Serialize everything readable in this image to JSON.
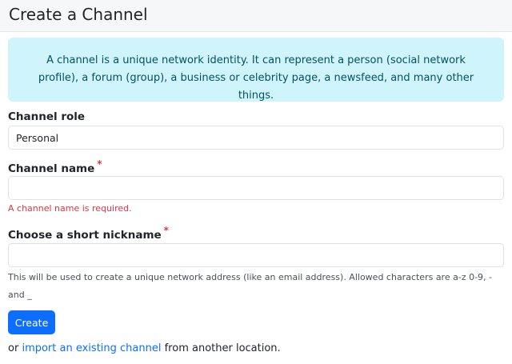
{
  "header": {
    "title": "Create a Channel"
  },
  "info": {
    "text": "A channel is a unique network identity. It can represent a person (social network profile), a forum (group), a business or celebrity page, a newsfeed, and many other things."
  },
  "form": {
    "role_label": "Channel role",
    "role_value": "Personal",
    "name_label": "Channel name",
    "name_required_mark": "*",
    "name_value": "",
    "name_error": "A channel name is required.",
    "nickname_label": "Choose a short nickname",
    "nickname_required_mark": "*",
    "nickname_value": "",
    "nickname_help": "This will be used to create a unique network address (like an email address). Allowed characters are a-z 0-9, - and _",
    "submit_label": "Create"
  },
  "footer": {
    "prefix": "or",
    "link_text": "import an existing channel",
    "suffix": "from another location."
  },
  "colors": {
    "primary": "#0d6efd",
    "info_bg": "#cff4fc",
    "info_text": "#055160",
    "error": "#dc3545"
  }
}
